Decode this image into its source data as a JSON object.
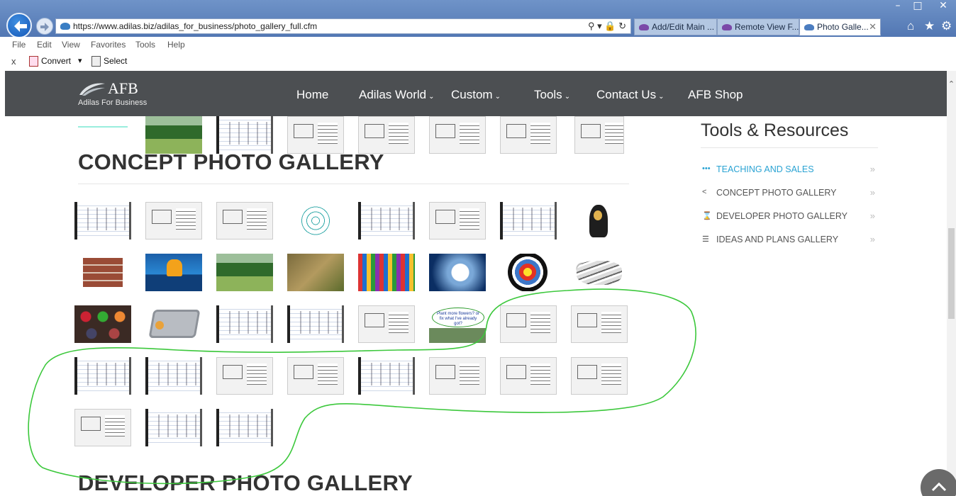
{
  "browser": {
    "url": "https://www.adilas.biz/adilas_for_business/photo_gallery_full.cfm",
    "tabs": [
      {
        "label": "Add/Edit Main ...",
        "active": false
      },
      {
        "label": "Remote View F...",
        "active": false
      },
      {
        "label": "Photo Galle...",
        "active": true
      }
    ],
    "menu": [
      "File",
      "Edit",
      "View",
      "Favorites",
      "Tools",
      "Help"
    ],
    "commands": {
      "close": "x",
      "convert": "Convert",
      "convert_arrow": "▾",
      "select": "Select"
    },
    "window_controls": {
      "minimize": "–",
      "maximize": "□",
      "close": "✕"
    },
    "address_tools": "⚲ ▾ 🔒 ↻",
    "tab_close": "✕",
    "toolbar_icons": {
      "home": "⌂",
      "favorites": "★",
      "settings": "⚙"
    }
  },
  "site": {
    "logo_name": "AFB",
    "logo_tagline": "Adilas For Business",
    "nav": [
      {
        "label": "Home",
        "dropdown": false
      },
      {
        "label": "Adilas World",
        "dropdown": true
      },
      {
        "label": "Custom",
        "dropdown": true
      },
      {
        "label": "Tools",
        "dropdown": true
      },
      {
        "label": "Contact Us",
        "dropdown": true
      },
      {
        "label": "AFB Shop",
        "dropdown": false
      }
    ],
    "dropdown_chevron": "⌄"
  },
  "gallery": {
    "concept_title": "CONCEPT PHOTO GALLERY",
    "developer_title": "DEVELOPER PHOTO GALLERY",
    "flower_caption": "Plant more flowers? or fix what I've already got?"
  },
  "sidebar": {
    "title": "Tools & Resources",
    "items": [
      {
        "label": "TEACHING AND SALES",
        "icon": "ellipsis-icon",
        "glyph": "•••",
        "active": true
      },
      {
        "label": "CONCEPT PHOTO GALLERY",
        "icon": "share-icon",
        "glyph": "<",
        "active": false
      },
      {
        "label": "DEVELOPER PHOTO GALLERY",
        "icon": "hourglass-icon",
        "glyph": "⌛",
        "active": false
      },
      {
        "label": "IDEAS AND PLANS GALLERY",
        "icon": "stack-icon",
        "glyph": "☰",
        "active": false
      }
    ],
    "arrow": "»"
  },
  "scroll": {
    "up_arrow": "⌃",
    "to_top": "⌃"
  },
  "colors": {
    "accent": "#2aa3d3",
    "nav_bg": "#4c4f52",
    "annotation": "#3cc83c"
  }
}
